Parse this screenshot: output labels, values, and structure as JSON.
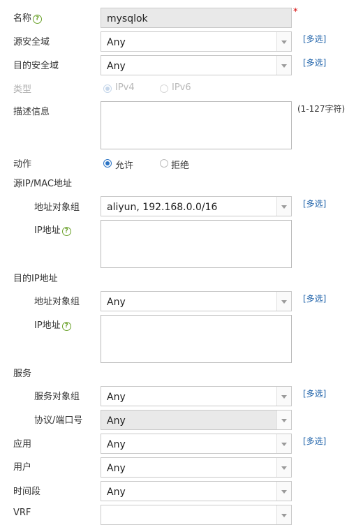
{
  "name": {
    "label": "名称",
    "value": "mysqlok",
    "required": "*"
  },
  "src_zone": {
    "label": "源安全域",
    "value": "Any",
    "multi": "[多选]"
  },
  "dst_zone": {
    "label": "目的安全域",
    "value": "Any",
    "multi": "[多选]"
  },
  "type": {
    "label": "类型",
    "options": [
      "IPv4",
      "IPv6"
    ],
    "selected": "IPv4"
  },
  "description": {
    "label": "描述信息",
    "hint": "(1-127字符)"
  },
  "action": {
    "label": "动作",
    "options": [
      "允许",
      "拒绝"
    ],
    "selected": "允许"
  },
  "src_addr": {
    "section": "源IP/MAC地址",
    "group_label": "地址对象组",
    "group_value": "aliyun, 192.168.0.0/16",
    "multi": "[多选]",
    "ip_label": "IP地址"
  },
  "dst_addr": {
    "section": "目的IP地址",
    "group_label": "地址对象组",
    "group_value": "Any",
    "multi": "[多选]",
    "ip_label": "IP地址"
  },
  "service": {
    "section": "服务",
    "group_label": "服务对象组",
    "group_value": "Any",
    "multi": "[多选]",
    "proto_label": "协议/端口号",
    "proto_value": "Any"
  },
  "app": {
    "label": "应用",
    "value": "Any",
    "multi": "[多选]"
  },
  "user": {
    "label": "用户",
    "value": "Any"
  },
  "time": {
    "label": "时间段",
    "value": "Any"
  },
  "vrf": {
    "label": "VRF"
  },
  "colors": {
    "link": "#1a5fa8",
    "help": "#6aa12a",
    "required": "#d40000",
    "radio_on": "#2a73c4"
  }
}
